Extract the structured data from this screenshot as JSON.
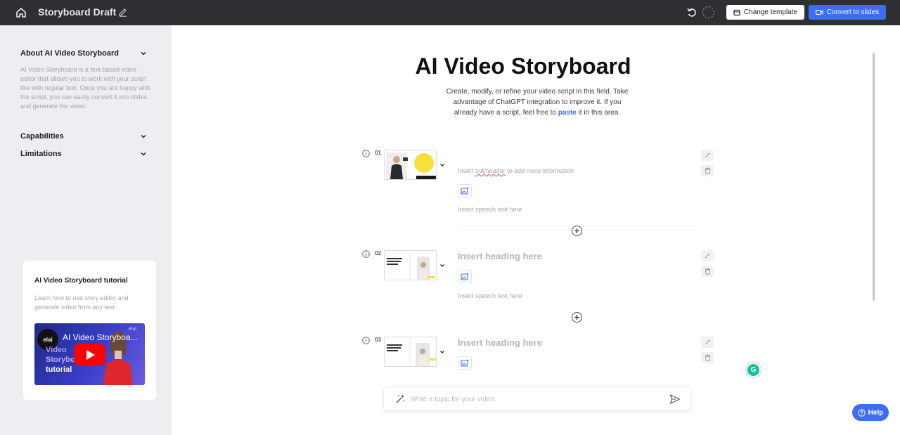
{
  "topbar": {
    "title": "Storyboard Draft",
    "change_template_label": "Change template",
    "convert_label": "Convert to slides"
  },
  "sidebar": {
    "sections": [
      {
        "title": "About AI Video Storyboard",
        "expanded": true,
        "text": "AI Video Storyboard is a text based video editor that allows you to work with your script like with regular text. Once you are happy with the script, you can easily convert it into slides and generate the video."
      },
      {
        "title": "Capabilities",
        "expanded": false
      },
      {
        "title": "Limitations",
        "expanded": false
      }
    ],
    "tutorial": {
      "title": "AI Video Storyboard tutorial",
      "description": "Learn how to use story editor and generate video from any text",
      "video_title": "AI Video Storyboa...",
      "logo": "elai",
      "watermark": "elai",
      "overlay_lines": [
        "Video",
        "Storyboard",
        "tutorial"
      ]
    }
  },
  "main": {
    "title": "AI Video Storyboard",
    "description_before": "Create, modify, or refine your video script in this field. Take advantage of ChatGPT integration to improve it. If you already have a script, feel free to ",
    "description_link": "paste",
    "description_after": " it in this area.",
    "slides": [
      {
        "number": "01",
        "thumb_text": "Fun for clarity, behind the word mountains",
        "subheader_pre": "Insert ",
        "subheader_word": "subheader",
        "subheader_post": " to add more information",
        "speech": "Insert speech text here"
      },
      {
        "number": "02",
        "thumb_text": "Fun for clarity, behind the word mountains",
        "heading": "Insert heading here",
        "speech": "Insert speech text here"
      },
      {
        "number": "03",
        "thumb_text": "Fun for clarity, behind the word mountains",
        "heading": "Insert heading here"
      }
    ],
    "topic_placeholder": "Write a topic for your video"
  },
  "widgets": {
    "grammarly_letter": "G",
    "help_label": "Help"
  },
  "colors": {
    "topbar": "#2d2f33",
    "accent": "#3d6df2",
    "sidebar": "#eceef1",
    "thumb_yellow": "#f7e03c",
    "video_red": "#ff0000"
  }
}
